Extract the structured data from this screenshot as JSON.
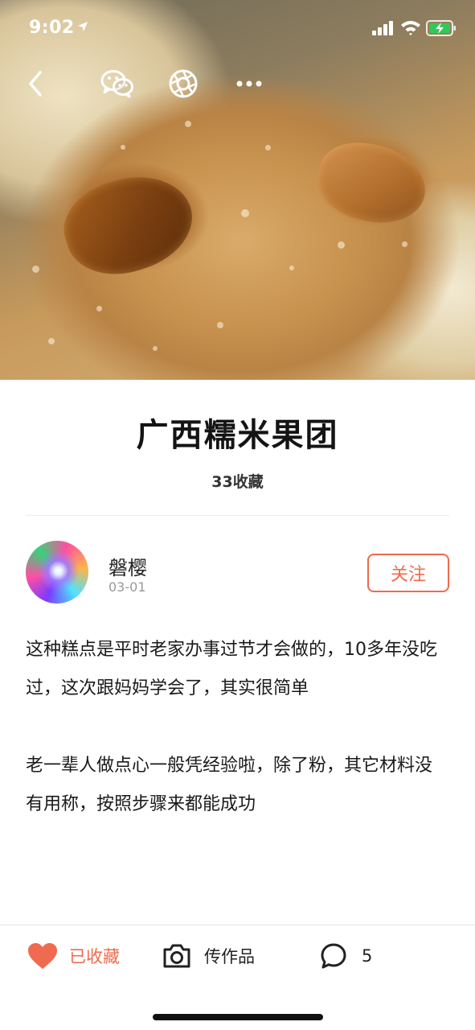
{
  "status_bar": {
    "time": "9:02",
    "icons": [
      "location-arrow-icon",
      "cellular-signal-icon",
      "wifi-icon",
      "battery-charging-icon"
    ]
  },
  "nav": {
    "icons": [
      "back-chevron-icon",
      "wechat-icon",
      "moments-icon",
      "more-icon"
    ]
  },
  "recipe": {
    "title": "广西糯米果团",
    "favorites_text": "33收藏"
  },
  "author": {
    "name": "磐樱",
    "date": "03-01",
    "follow_label": "关注"
  },
  "description": {
    "paragraph_1": "这种糕点是平时老家办事过节才会做的，10多年没吃过，这次跟妈妈学会了，其实很简单",
    "paragraph_2": "老一辈人做点心一般凭经验啦，除了粉，其它材料没有用称，按照步骤来都能成功"
  },
  "bottom_bar": {
    "favorited_label": "已收藏",
    "upload_label": "传作品",
    "comment_count": "5"
  },
  "colors": {
    "accent": "#ef6a4f",
    "text_primary": "#1a1a1a",
    "text_secondary": "#999999"
  }
}
